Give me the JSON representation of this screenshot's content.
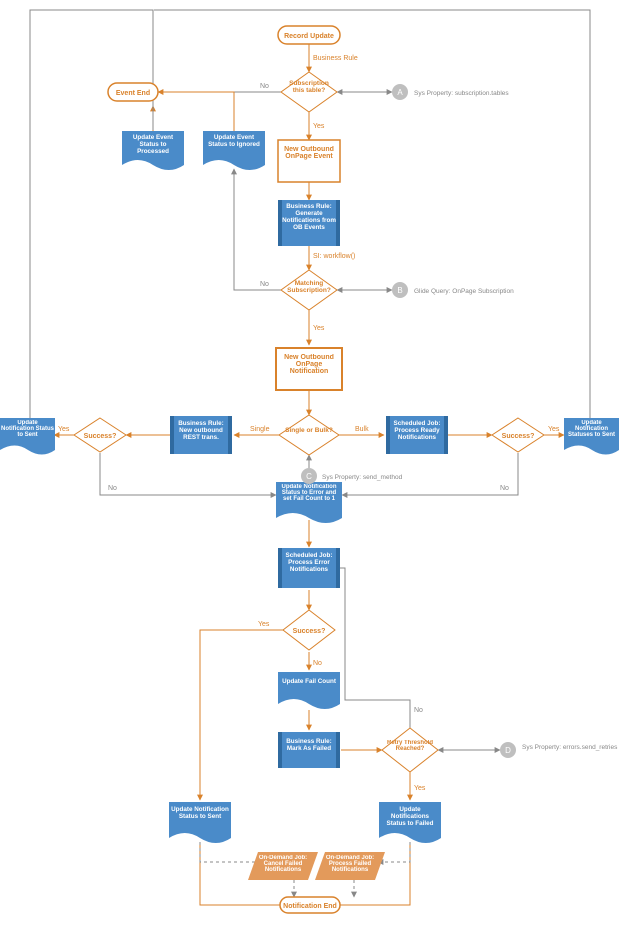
{
  "nodes": {
    "start": "Record Update",
    "dec_sub": "Subscription this table?",
    "event_end": "Event End",
    "upd_processed": "Update Event Status to Processed",
    "upd_ignored": "Update Event Status to Ignored",
    "new_ob_event": "New Outbound OnPage Event",
    "br_gen": "Business Rule: Generate Notifications from OB Events",
    "dec_match": "Matching Subscription?",
    "new_ob_notif": "New Outbound OnPage Notification",
    "dec_single": "Single or Bulk?",
    "br_rest": "Business Rule: New outbound REST trans.",
    "sj_ready": "Scheduled Job: Process Ready Notifications",
    "dec_succL": "Success?",
    "dec_succR": "Success?",
    "upd_sentL": "Update Notification Status to Sent",
    "upd_sentR": "Update Notification Statuses to Sent",
    "upd_err": "Update Notification Status to Error and set Fail Count to 1",
    "sj_err": "Scheduled Job: Process Error Notifications",
    "dec_succ3": "Success?",
    "upd_fail_cnt": "Update Fail Count",
    "br_mark_failed": "Business Rule: Mark As Failed",
    "dec_retry": "Retry Threshold Reached?",
    "upd_sent2": "Update Notification Status to Sent",
    "upd_failed": "Update Notifications Status to Failed",
    "od_cancel": "On-Demand Job: Cancel Failed Notifications",
    "od_process": "On-Demand Job: Process Failed Notifications",
    "notif_end": "Notification End"
  },
  "edgeLabels": {
    "br": "Business Rule",
    "yes": "Yes",
    "no": "No",
    "single": "Single",
    "bulk": "Bulk",
    "si": "SI: workflow()"
  },
  "notes": {
    "A": {
      "letter": "A",
      "text": "Sys Property: subscription.tables"
    },
    "B": {
      "letter": "B",
      "text": "Glide Query: OnPage Subscription"
    },
    "C": {
      "letter": "C",
      "text": "Sys Property: send_method"
    },
    "D": {
      "letter": "D",
      "text": "Sys Property: errors.send_retries"
    }
  }
}
